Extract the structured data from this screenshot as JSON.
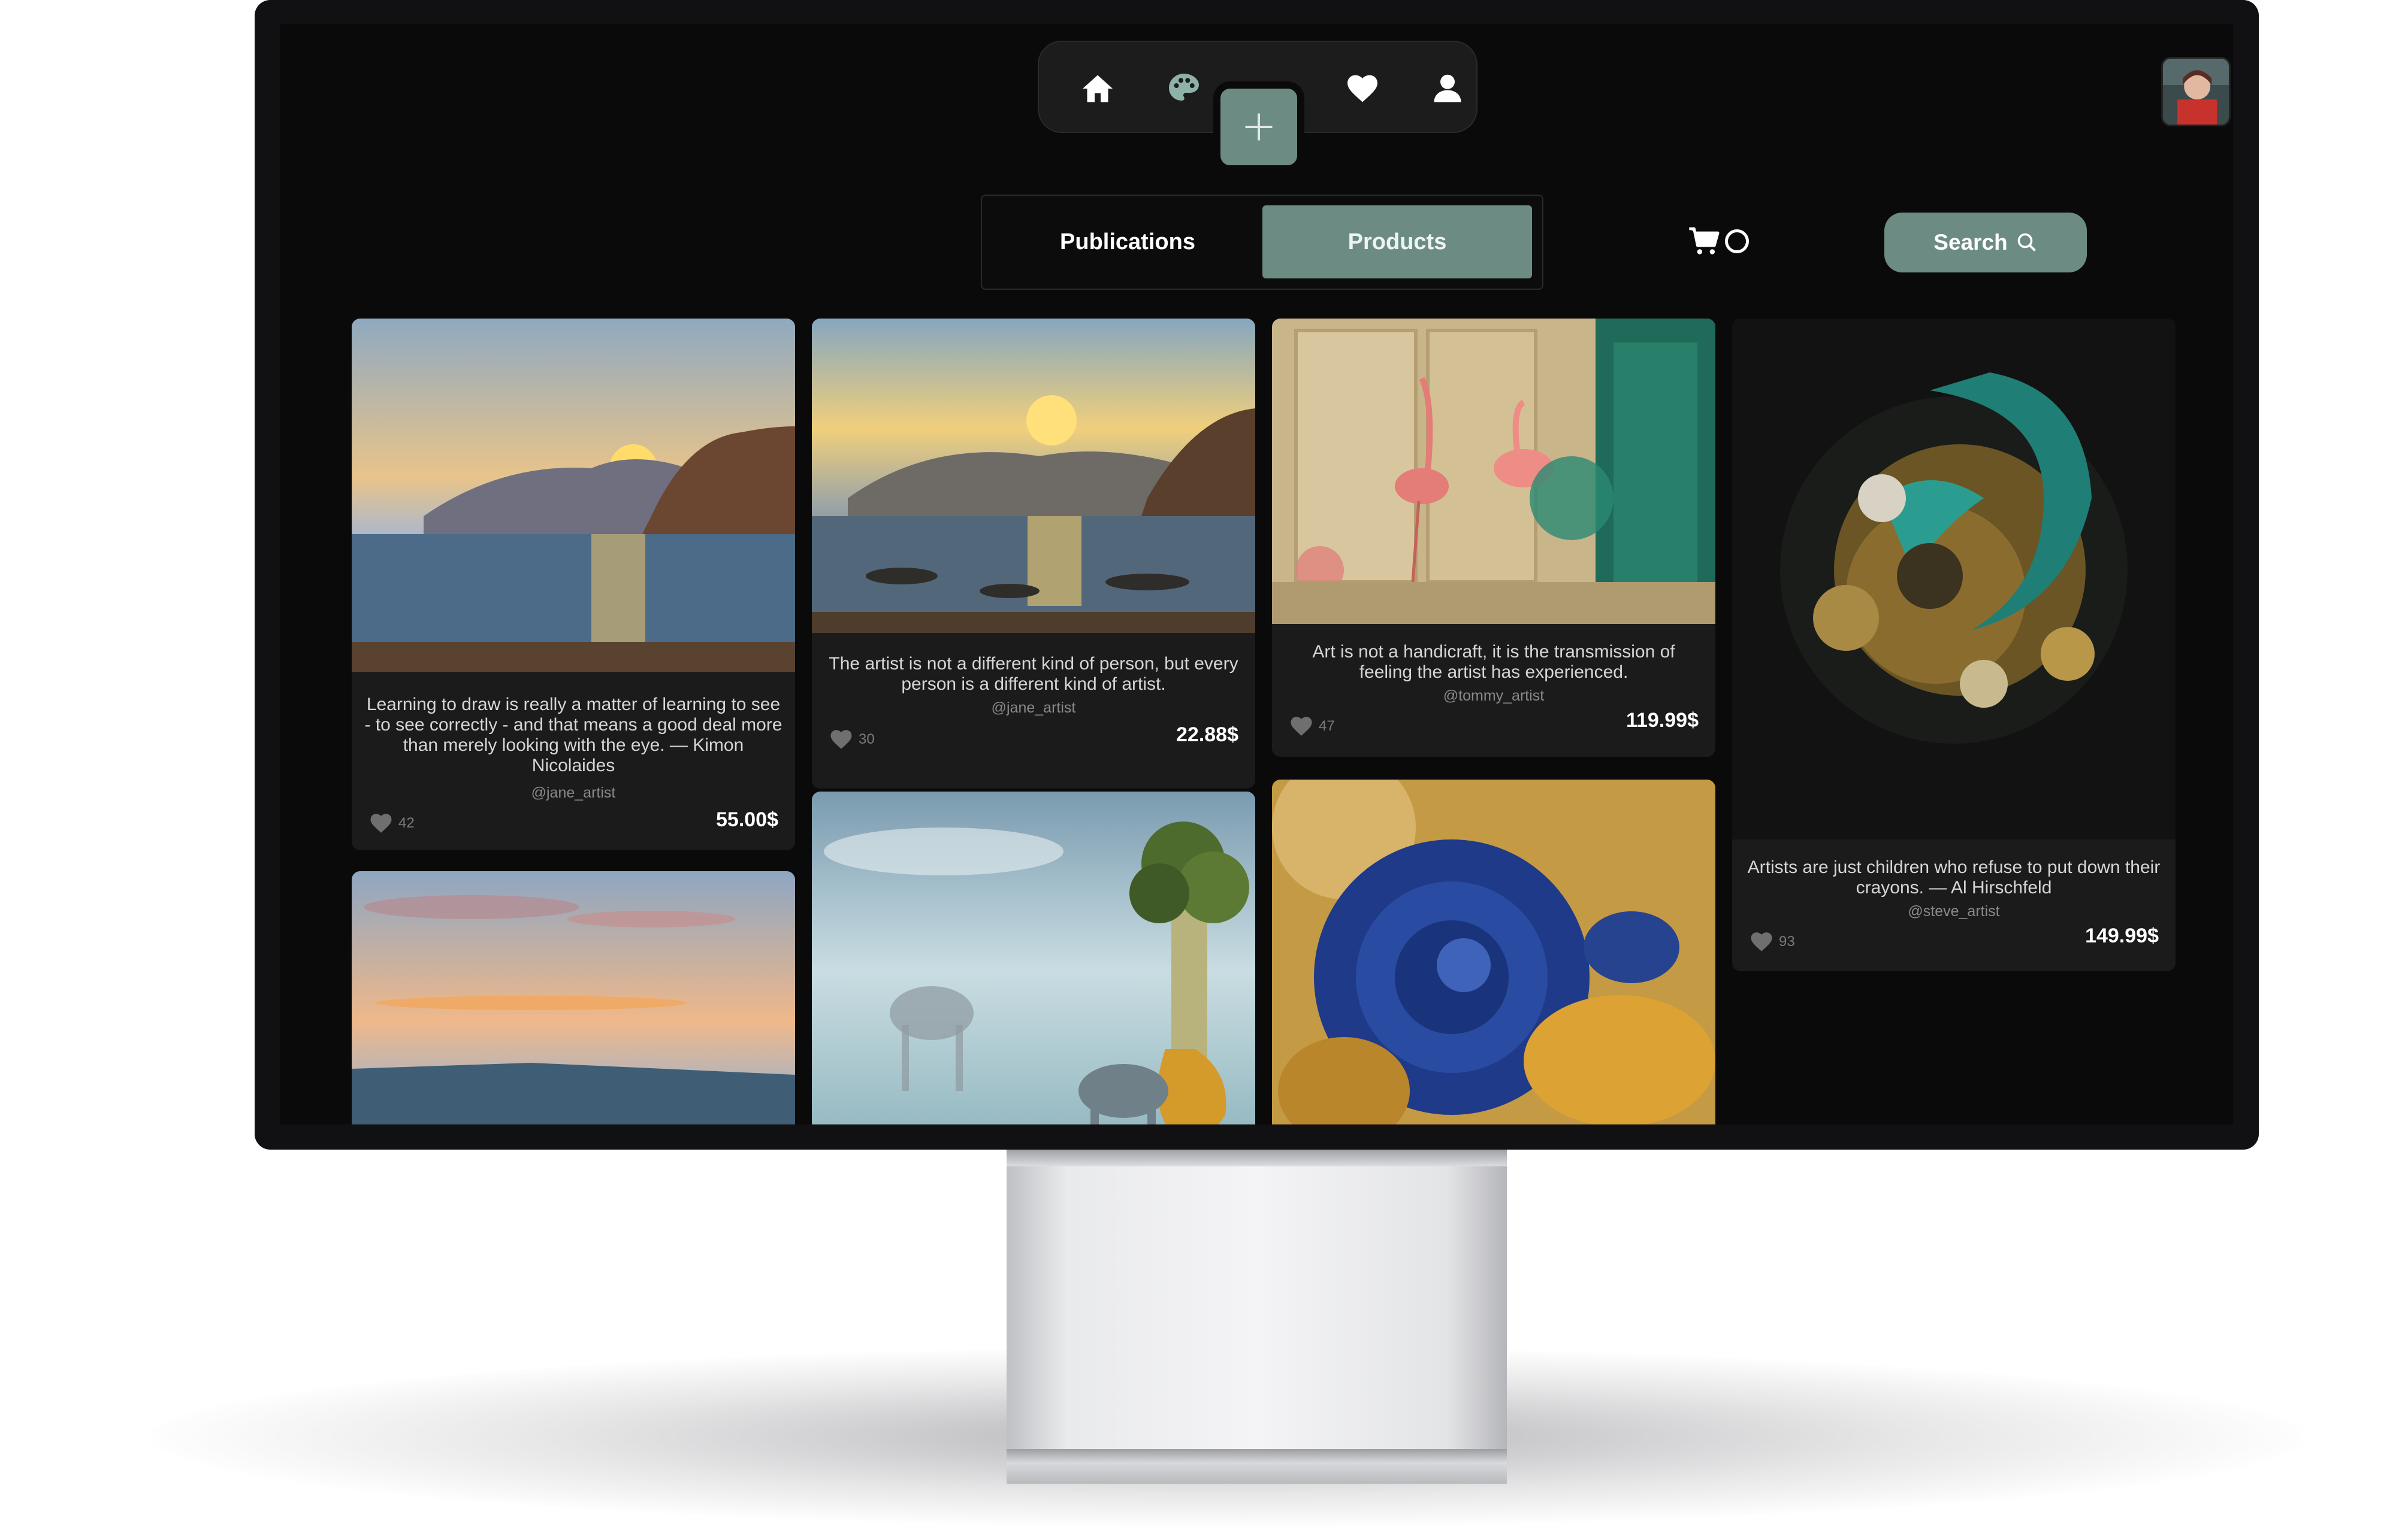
{
  "nav": {
    "icons": [
      "home-icon",
      "palette-icon",
      "heart-icon",
      "user-icon",
      "plus-icon"
    ]
  },
  "tabs": [
    {
      "label": "Publications",
      "active": false
    },
    {
      "label": "Products",
      "active": true
    }
  ],
  "cart": {
    "count": "0"
  },
  "search": {
    "label": "Search"
  },
  "colors": {
    "accent": "#6c8c83",
    "background": "#0a0a0a",
    "card": "#1b1b1b"
  },
  "cards": [
    {
      "quote": "Learning to draw is really a matter of learning to see - to see correctly - and that means a good deal more than merely looking with the eye. — Kimon Nicolaides",
      "author": "@jane_artist",
      "likes": "42",
      "price": "55.00$",
      "image": "sunset-sea-painting"
    },
    {
      "quote": "The artist is not a different kind of person, but every person is a different kind of artist.",
      "author": "@jane_artist",
      "likes": "30",
      "price": "22.88$",
      "image": "sunset-cliffs-painting"
    },
    {
      "quote": "Art is not a handicraft, it is the transmission of feeling the artist has experienced.",
      "author": "@tommy_artist",
      "likes": "47",
      "price": "119.99$",
      "image": "flamingo-painting"
    },
    {
      "quote": "Artists are just children who refuse to put down their crayons. — Al Hirschfeld",
      "author": "@steve_artist",
      "likes": "93",
      "price": "149.99$",
      "image": "ornate-teal-gold-artwork"
    }
  ]
}
